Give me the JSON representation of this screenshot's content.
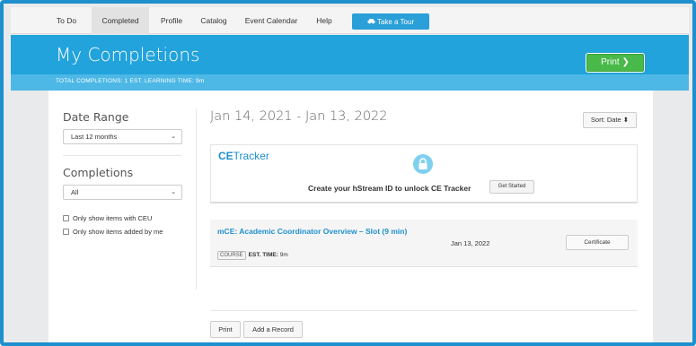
{
  "nav": {
    "items": [
      {
        "label": "To Do"
      },
      {
        "label": "Completed"
      },
      {
        "label": "Profile"
      },
      {
        "label": "Catalog"
      },
      {
        "label": "Event Calendar"
      },
      {
        "label": "Help"
      }
    ],
    "tour_label": "Take a Tour",
    "tour_icon": "car-icon"
  },
  "header": {
    "title": "My Completions",
    "stats": "TOTAL COMPLETIONS: 1   EST. LEARNING TIME: 9m",
    "print_label": "Print ❯"
  },
  "sidebar": {
    "date_range_heading": "Date Range",
    "date_range_value": "Last 12 months",
    "completions_heading": "Completions",
    "completions_value": "All",
    "checkbox_ceu": "Only show items with CEU",
    "checkbox_added": "Only show items added by me"
  },
  "main": {
    "date_range": "Jan 14, 2021 - Jan 13, 2022",
    "sort_label": "Sort: Date ⬍",
    "ce_tracker": {
      "logo_bold": "CE",
      "logo_light": "Tracker",
      "message": "Create your hStream ID to unlock CE Tracker",
      "button": "Get Started"
    },
    "completion": {
      "title": "mCE: Academic Coordinator Overview – Slot (9 min)",
      "tag": "COURSE",
      "est_label": "EST. TIME:",
      "est_value": "9m",
      "date": "Jan 13, 2022",
      "certificate_label": "Certificate"
    },
    "print_label": "Print",
    "add_record_label": "Add a Record"
  },
  "colors": {
    "brand_blue": "#22a3dc",
    "link_blue": "#1e90ce",
    "print_green": "#49b949"
  }
}
